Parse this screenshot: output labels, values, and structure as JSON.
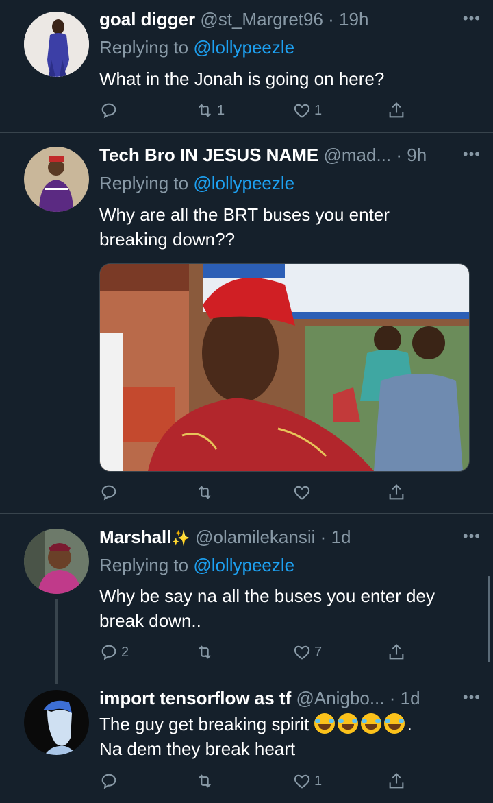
{
  "tweets": [
    {
      "name": "goal digger",
      "handle": "@st_Margret96",
      "time": "· 19h",
      "replying_prefix": "Replying to",
      "replying_to": "@lollypeezle",
      "text": "What in the Jonah is going on here?",
      "retweets": "1",
      "likes": "1",
      "replies": ""
    },
    {
      "name": "Tech Bro IN JESUS NAME",
      "handle": "@mad...",
      "time": "· 9h",
      "replying_prefix": "Replying to",
      "replying_to": "@lollypeezle",
      "text_line1": "Why are all the BRT buses you enter",
      "text_line2": "breaking down??",
      "retweets": "",
      "likes": "",
      "replies": ""
    },
    {
      "name": "Marshall",
      "handle": "@olamilekansii",
      "time": "· 1d",
      "replying_prefix": "Replying to",
      "replying_to": "@lollypeezle",
      "text_line1": "Why be say na all the buses you enter dey",
      "text_line2": "break down..",
      "replies": "2",
      "retweets": "",
      "likes": "7"
    },
    {
      "name": "import tensorflow as tf",
      "handle": "@Anigbo...",
      "time": "· 1d",
      "text_line1_prefix": "The guy get breaking spirit",
      "text_line1_suffix": ".",
      "text_line2": "Na dem they break heart",
      "replies": "",
      "retweets": "",
      "likes": "1"
    }
  ],
  "colors": {
    "background": "#15202b",
    "secondary_text": "#8899a6",
    "link": "#1da1f2",
    "divider": "#38444d"
  },
  "icons": [
    "reply-icon",
    "retweet-icon",
    "like-icon",
    "share-icon",
    "more-icon",
    "sparkles-emoji",
    "tears-of-joy-emoji"
  ]
}
